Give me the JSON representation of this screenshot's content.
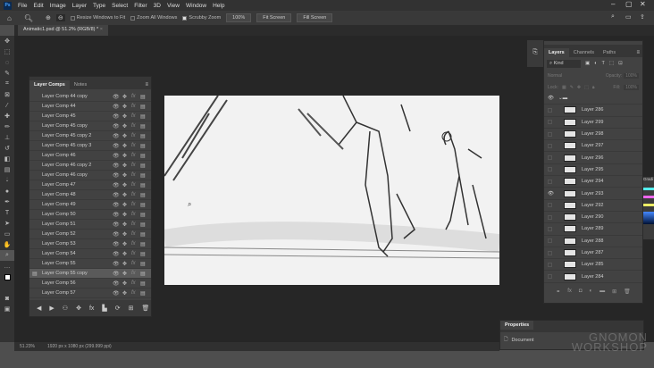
{
  "app_logo": "Ps",
  "menu": [
    "File",
    "Edit",
    "Image",
    "Layer",
    "Type",
    "Select",
    "Filter",
    "3D",
    "View",
    "Window",
    "Help"
  ],
  "options": {
    "resize_windows": "Resize Windows to Fit",
    "zoom_all": "Zoom All Windows",
    "scrubby": "Scrubby Zoom",
    "zoom_value": "100%",
    "fit_screen": "Fit Screen",
    "fill_screen": "Fill Screen"
  },
  "document_tab": {
    "title": "Animatic1.psd @ 51.2% (RGB/8) *",
    "close": "×"
  },
  "layer_comps": {
    "tabs": [
      "Layer Comps",
      "Notes"
    ],
    "items": [
      "Layer Comp 44 copy",
      "Layer Comp 44",
      "Layer Comp 45",
      "Layer Comp 45 copy",
      "Layer Comp 45 copy 2",
      "Layer Comp 45 copy 3",
      "Layer Comp 46",
      "Layer Comp 46 copy 2",
      "Layer Comp 46 copy",
      "Layer Comp 47",
      "Layer Comp 48",
      "Layer Comp 49",
      "Layer Comp 50",
      "Layer Comp 51",
      "Layer Comp 52",
      "Layer Comp 53",
      "Layer Comp 54",
      "Layer Comp 55",
      "Layer Comp 55 copy",
      "Layer Comp 56",
      "Layer Comp 57"
    ],
    "selected": "Layer Comp 55 copy"
  },
  "layers": {
    "tabs": [
      "Layers",
      "Channels",
      "Paths"
    ],
    "filter": "Kind",
    "blend": "Normal",
    "opacity_label": "Opacity:",
    "opacity": "100%",
    "lock_label": "Lock:",
    "fill_label": "Fill:",
    "fill": "100%",
    "items": [
      "Layer 286",
      "Layer 299",
      "Layer 298",
      "Layer 297",
      "Layer 296",
      "Layer 295",
      "Layer 294",
      "Layer 293",
      "Layer 292",
      "Layer 290",
      "Layer 289",
      "Layer 288",
      "Layer 287",
      "Layer 285",
      "Layer 284"
    ],
    "visible": "Layer 293"
  },
  "properties": {
    "title": "Properties",
    "item": "Document"
  },
  "status": {
    "zoom": "51.23%",
    "dims": "1920 px x 1080 px (299.999 ppi)"
  },
  "watermark": "THE GNOMON WORKSHOP",
  "gradient_tab": "Gradi"
}
